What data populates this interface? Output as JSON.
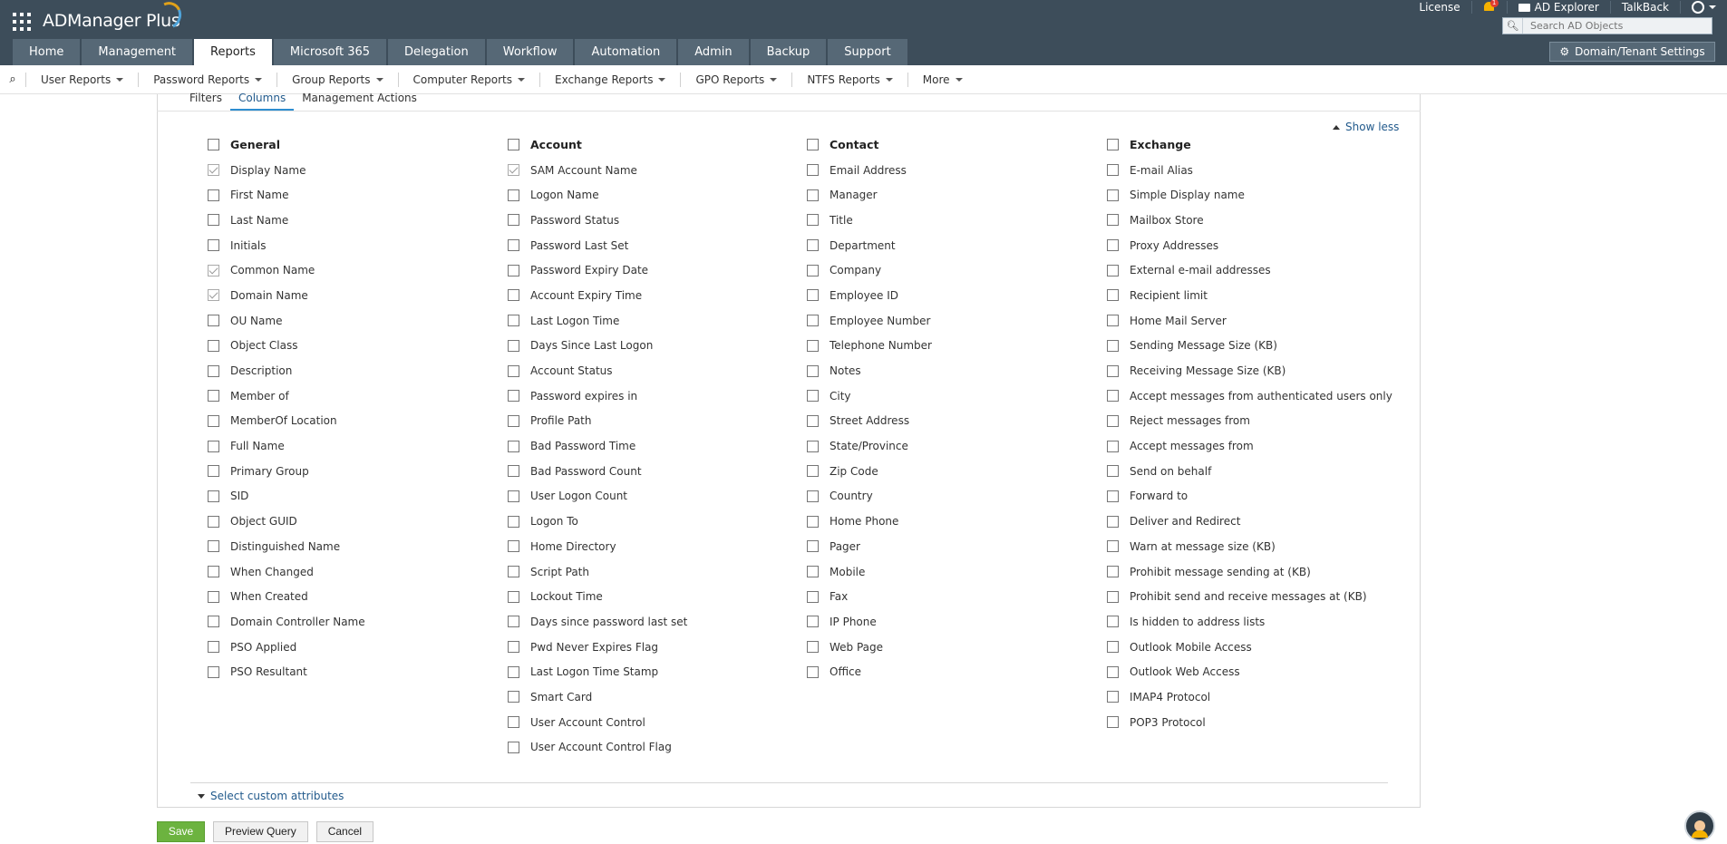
{
  "app": {
    "title": "ADManager Plus"
  },
  "toplinks": {
    "license": "License",
    "notifications_count": "1",
    "ad_explorer": "AD Explorer",
    "talkback": "TalkBack"
  },
  "search": {
    "placeholder": "Search AD Objects"
  },
  "tabs": [
    "Home",
    "Management",
    "Reports",
    "Microsoft 365",
    "Delegation",
    "Workflow",
    "Automation",
    "Admin",
    "Backup",
    "Support"
  ],
  "active_tab": "Reports",
  "domain_settings": "Domain/Tenant Settings",
  "subnav": [
    "User Reports",
    "Password Reports",
    "Group Reports",
    "Computer Reports",
    "Exchange Reports",
    "GPO Reports",
    "NTFS Reports",
    "More"
  ],
  "subtabs": [
    "Filters",
    "Columns",
    "Management Actions"
  ],
  "active_subtab": "Columns",
  "show_less": "Show less",
  "columns": [
    {
      "title": "General",
      "items": [
        {
          "label": "Display Name",
          "checked": true
        },
        {
          "label": "First Name",
          "checked": false
        },
        {
          "label": "Last Name",
          "checked": false
        },
        {
          "label": "Initials",
          "checked": false
        },
        {
          "label": "Common Name",
          "checked": true
        },
        {
          "label": "Domain Name",
          "checked": true
        },
        {
          "label": "OU Name",
          "checked": false
        },
        {
          "label": "Object Class",
          "checked": false
        },
        {
          "label": "Description",
          "checked": false
        },
        {
          "label": "Member of",
          "checked": false
        },
        {
          "label": "MemberOf Location",
          "checked": false
        },
        {
          "label": "Full Name",
          "checked": false
        },
        {
          "label": "Primary Group",
          "checked": false
        },
        {
          "label": "SID",
          "checked": false
        },
        {
          "label": "Object GUID",
          "checked": false
        },
        {
          "label": "Distinguished Name",
          "checked": false
        },
        {
          "label": "When Changed",
          "checked": false
        },
        {
          "label": "When Created",
          "checked": false
        },
        {
          "label": "Domain Controller Name",
          "checked": false
        },
        {
          "label": "PSO Applied",
          "checked": false
        },
        {
          "label": "PSO Resultant",
          "checked": false
        }
      ]
    },
    {
      "title": "Account",
      "items": [
        {
          "label": "SAM Account Name",
          "checked": true
        },
        {
          "label": "Logon Name",
          "checked": false
        },
        {
          "label": "Password Status",
          "checked": false
        },
        {
          "label": "Password Last Set",
          "checked": false
        },
        {
          "label": "Password Expiry Date",
          "checked": false
        },
        {
          "label": "Account Expiry Time",
          "checked": false
        },
        {
          "label": "Last Logon Time",
          "checked": false
        },
        {
          "label": "Days Since Last Logon",
          "checked": false
        },
        {
          "label": "Account Status",
          "checked": false
        },
        {
          "label": "Password expires in",
          "checked": false
        },
        {
          "label": "Profile Path",
          "checked": false
        },
        {
          "label": "Bad Password Time",
          "checked": false
        },
        {
          "label": "Bad Password Count",
          "checked": false
        },
        {
          "label": "User Logon Count",
          "checked": false
        },
        {
          "label": "Logon To",
          "checked": false
        },
        {
          "label": "Home Directory",
          "checked": false
        },
        {
          "label": "Script Path",
          "checked": false
        },
        {
          "label": "Lockout Time",
          "checked": false
        },
        {
          "label": "Days since password last set",
          "checked": false
        },
        {
          "label": "Pwd Never Expires Flag",
          "checked": false
        },
        {
          "label": "Last Logon Time Stamp",
          "checked": false
        },
        {
          "label": "Smart Card",
          "checked": false
        },
        {
          "label": "User Account Control",
          "checked": false
        },
        {
          "label": "User Account Control Flag",
          "checked": false
        }
      ]
    },
    {
      "title": "Contact",
      "items": [
        {
          "label": "Email Address",
          "checked": false
        },
        {
          "label": "Manager",
          "checked": false
        },
        {
          "label": "Title",
          "checked": false
        },
        {
          "label": "Department",
          "checked": false
        },
        {
          "label": "Company",
          "checked": false
        },
        {
          "label": "Employee ID",
          "checked": false
        },
        {
          "label": "Employee Number",
          "checked": false
        },
        {
          "label": "Telephone Number",
          "checked": false
        },
        {
          "label": "Notes",
          "checked": false
        },
        {
          "label": "City",
          "checked": false
        },
        {
          "label": "Street Address",
          "checked": false
        },
        {
          "label": "State/Province",
          "checked": false
        },
        {
          "label": "Zip Code",
          "checked": false
        },
        {
          "label": "Country",
          "checked": false
        },
        {
          "label": "Home Phone",
          "checked": false
        },
        {
          "label": "Pager",
          "checked": false
        },
        {
          "label": "Mobile",
          "checked": false
        },
        {
          "label": "Fax",
          "checked": false
        },
        {
          "label": "IP Phone",
          "checked": false
        },
        {
          "label": "Web Page",
          "checked": false
        },
        {
          "label": "Office",
          "checked": false
        }
      ]
    },
    {
      "title": "Exchange",
      "items": [
        {
          "label": "E-mail Alias",
          "checked": false
        },
        {
          "label": "Simple Display name",
          "checked": false
        },
        {
          "label": "Mailbox Store",
          "checked": false
        },
        {
          "label": "Proxy Addresses",
          "checked": false
        },
        {
          "label": "External e-mail addresses",
          "checked": false
        },
        {
          "label": "Recipient limit",
          "checked": false
        },
        {
          "label": "Home Mail Server",
          "checked": false
        },
        {
          "label": "Sending Message Size (KB)",
          "checked": false
        },
        {
          "label": "Receiving Message Size (KB)",
          "checked": false
        },
        {
          "label": "Accept messages from authenticated users only",
          "checked": false
        },
        {
          "label": "Reject messages from",
          "checked": false
        },
        {
          "label": "Accept messages from",
          "checked": false
        },
        {
          "label": "Send on behalf",
          "checked": false
        },
        {
          "label": "Forward to",
          "checked": false
        },
        {
          "label": "Deliver and Redirect",
          "checked": false
        },
        {
          "label": "Warn at message size (KB)",
          "checked": false
        },
        {
          "label": "Prohibit message sending at (KB)",
          "checked": false
        },
        {
          "label": "Prohibit send and receive messages at (KB)",
          "checked": false
        },
        {
          "label": "Is hidden to address lists",
          "checked": false
        },
        {
          "label": "Outlook Mobile Access",
          "checked": false
        },
        {
          "label": "Outlook Web Access",
          "checked": false
        },
        {
          "label": "IMAP4 Protocol",
          "checked": false
        },
        {
          "label": "POP3 Protocol",
          "checked": false
        }
      ]
    }
  ],
  "custom_attributes": "Select custom attributes",
  "buttons": {
    "save": "Save",
    "preview": "Preview Query",
    "cancel": "Cancel"
  },
  "colors": {
    "topbar": "#3d4d5a",
    "tab": "#566876",
    "link": "#225a8c",
    "save": "#6cb33f"
  }
}
